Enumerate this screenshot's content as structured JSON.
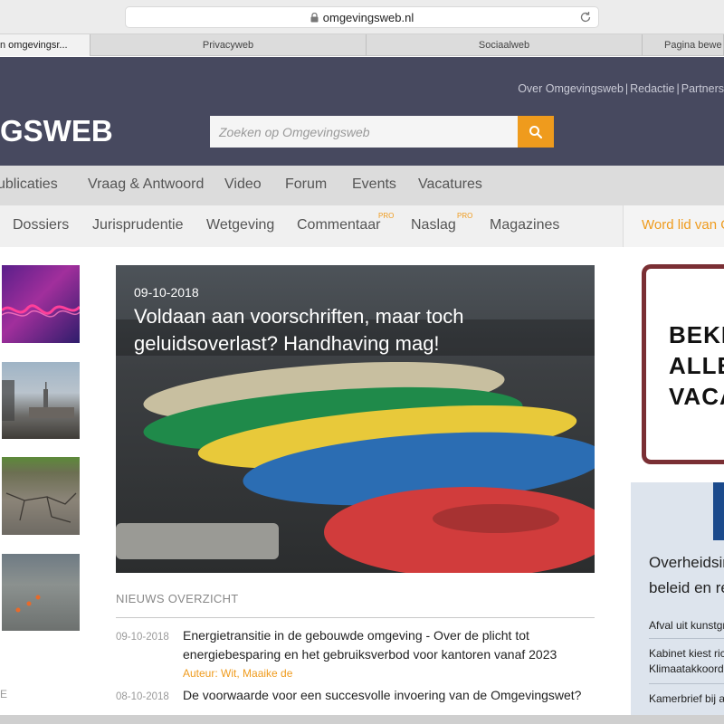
{
  "browser": {
    "url": "omgevingsweb.nl",
    "tabs": [
      "n omgevingsr...",
      "Privacyweb",
      "Sociaalweb",
      "Pagina bewe"
    ]
  },
  "header": {
    "top_links": [
      "Over Omgevingsweb",
      "Redactie",
      "Partners"
    ],
    "logo": "GSWEB",
    "search_placeholder": "Zoeken op Omgevingsweb"
  },
  "nav_primary": [
    "ublicaties",
    "Vraag & Antwoord",
    "Video",
    "Forum",
    "Events",
    "Vacatures"
  ],
  "nav_secondary": {
    "items": [
      "Dossiers",
      "Jurisprudentie",
      "Wetgeving",
      "Commentaar",
      "Naslag",
      "Magazines"
    ],
    "pro_badge": "PRO",
    "join": "Word lid van O"
  },
  "hero": {
    "date": "09-10-2018",
    "title": "Voldaan aan voorschriften, maar toch geluidsoverlast? Handhaving mag!"
  },
  "news": {
    "heading": "NIEUWS OVERZICHT",
    "items": [
      {
        "date": "09-10-2018",
        "title": "Energietransitie in de gebouwde omgeving - Over de plicht tot energiebesparing en het gebruiksverbod voor kantoren vanaf 2023",
        "author": "Auteur: Wit, Maaike de"
      },
      {
        "date": "08-10-2018",
        "title": "De voorwaarde voor een succesvolle invoering van de Omgevingswet?"
      }
    ]
  },
  "left_column": {
    "fragment": "E"
  },
  "right_column": {
    "ad_lines": [
      "BEKI",
      "ALLE",
      "VACA"
    ],
    "gov_title_lines": [
      "Overheidsir",
      "beleid en re"
    ],
    "gov_links": [
      "Afval uit kunstgr",
      "Kabinet kiest ric",
      "Klimaatakkoord",
      "Kamerbrief bij a"
    ]
  },
  "colors": {
    "header_bg": "#47495f",
    "accent": "#ef9b1d",
    "nav_bg": "#dcdcdc"
  }
}
